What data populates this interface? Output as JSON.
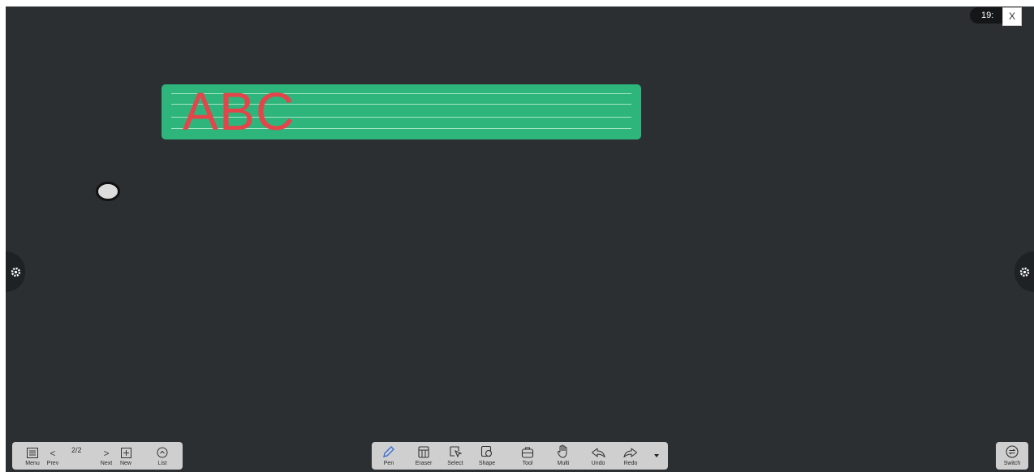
{
  "page": {
    "indicator": "2/2"
  },
  "clock": {
    "text": "19:"
  },
  "close": {
    "label": "X"
  },
  "board": {
    "text": "ABC"
  },
  "colors": {
    "canvas": "#2b2f32",
    "board": "#2db57c",
    "board_text": "#e4454a",
    "toolbar": "#cfcfcf",
    "active_tool": "#4a7fe0"
  },
  "left_toolbar": {
    "menu": "Menu",
    "prev": "Prev",
    "next": "Next",
    "new": "New",
    "list": "List",
    "prev_chevron": "<",
    "next_chevron": ">"
  },
  "main_toolbar": {
    "tools": [
      {
        "label": "Pen",
        "icon": "pen-icon"
      },
      {
        "label": "Eraser",
        "icon": "eraser-icon"
      },
      {
        "label": "Select",
        "icon": "select-icon"
      },
      {
        "label": "Shape",
        "icon": "shape-icon"
      },
      {
        "label": "Tool",
        "icon": "toolbox-icon"
      },
      {
        "label": "Multi",
        "icon": "hand-icon"
      },
      {
        "label": "Undo",
        "icon": "undo-icon"
      },
      {
        "label": "Redo",
        "icon": "redo-icon"
      }
    ],
    "active": "Pen",
    "more_icon": "caret-down-icon"
  },
  "switch": {
    "label": "Switch",
    "icon": "switch-icon"
  }
}
